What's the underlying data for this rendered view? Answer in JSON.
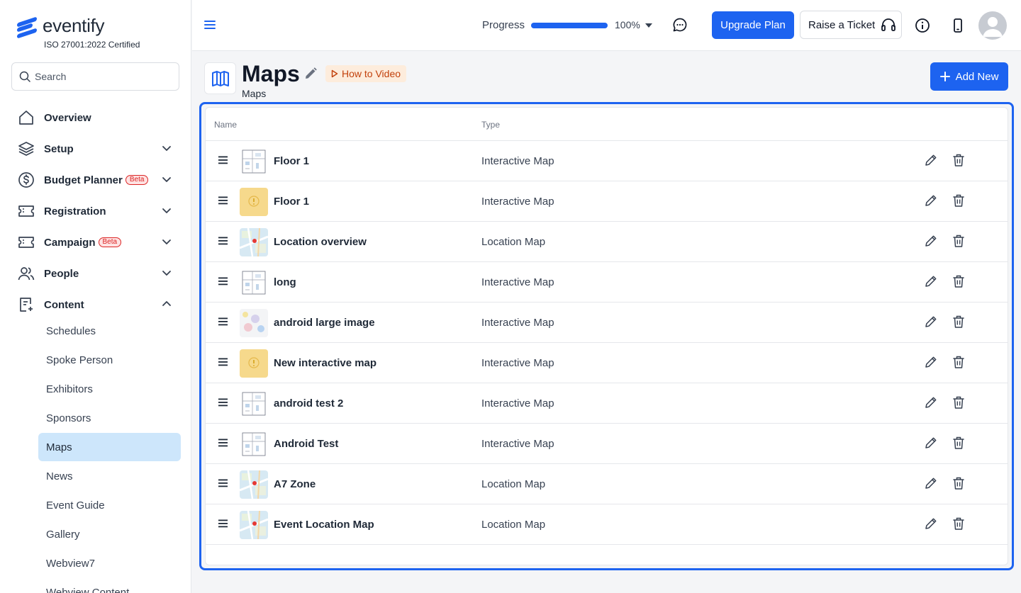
{
  "brand": {
    "name": "eventify",
    "certification": "ISO 27001:2022 Certified"
  },
  "search": {
    "placeholder": "Search"
  },
  "nav": [
    {
      "label": "Overview",
      "icon": "home-icon",
      "expand": "none",
      "beta": ""
    },
    {
      "label": "Setup",
      "icon": "layers-icon",
      "expand": "collapsed",
      "beta": ""
    },
    {
      "label": "Budget Planner",
      "icon": "dollar-icon",
      "expand": "collapsed",
      "beta": "Beta"
    },
    {
      "label": "Registration",
      "icon": "ticket-icon",
      "expand": "collapsed",
      "beta": ""
    },
    {
      "label": "Campaign",
      "icon": "ticket-icon",
      "expand": "collapsed",
      "beta": "Beta"
    },
    {
      "label": "People",
      "icon": "people-icon",
      "expand": "collapsed",
      "beta": ""
    },
    {
      "label": "Content",
      "icon": "content-icon",
      "expand": "expanded",
      "beta": ""
    }
  ],
  "content_items": [
    "Schedules",
    "Spoke Person",
    "Exhibitors",
    "Sponsors",
    "Maps",
    "News",
    "Event Guide",
    "Gallery",
    "Webview7",
    "Webview Content"
  ],
  "active_content_item": "Maps",
  "topbar": {
    "progress_label": "Progress",
    "progress_value": 100,
    "progress_text": "100%",
    "upgrade_label": "Upgrade Plan",
    "ticket_label": "Raise a Ticket"
  },
  "page": {
    "title": "Maps",
    "subtitle": "Maps",
    "how_to_label": "How to Video",
    "add_new_label": "Add New"
  },
  "table": {
    "headers": {
      "name": "Name",
      "type": "Type"
    },
    "rows": [
      {
        "name": "Floor 1",
        "type": "Interactive Map",
        "thumb": "floorplan"
      },
      {
        "name": "Floor 1",
        "type": "Interactive Map",
        "thumb": "warning"
      },
      {
        "name": "Location overview",
        "type": "Location Map",
        "thumb": "map"
      },
      {
        "name": "long",
        "type": "Interactive Map",
        "thumb": "floorplan"
      },
      {
        "name": "android large image",
        "type": "Interactive Map",
        "thumb": "blur"
      },
      {
        "name": "New interactive map",
        "type": "Interactive Map",
        "thumb": "warning"
      },
      {
        "name": "android test 2",
        "type": "Interactive Map",
        "thumb": "floorplan"
      },
      {
        "name": "Android Test",
        "type": "Interactive Map",
        "thumb": "floorplan"
      },
      {
        "name": "A7 Zone",
        "type": "Location Map",
        "thumb": "map"
      },
      {
        "name": "Event Location Map",
        "type": "Location Map",
        "thumb": "map"
      }
    ]
  },
  "colors": {
    "accent": "#1d63f0",
    "active_bg": "#cde6fb",
    "beta": "#dc2626",
    "how_to": "#c2410c"
  }
}
